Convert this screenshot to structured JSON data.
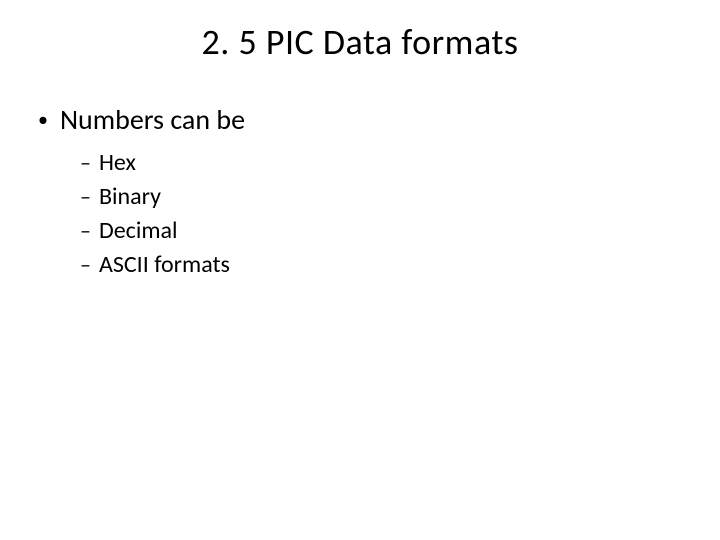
{
  "title": "2. 5 PIC Data formats",
  "main_bullet": "Numbers can be",
  "sub_items": {
    "item0": "Hex",
    "item1": "Binary",
    "item2": "Decimal",
    "item3": "ASCII formats"
  }
}
